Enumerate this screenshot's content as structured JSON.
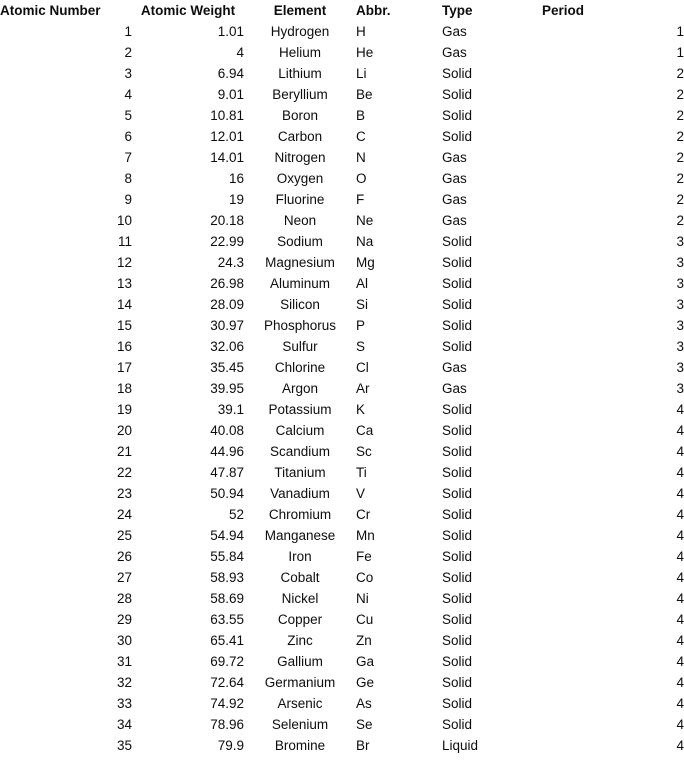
{
  "table": {
    "columns": [
      {
        "key": "atomic_number",
        "label": "Atomic Number",
        "align": "right"
      },
      {
        "key": "atomic_weight",
        "label": "Atomic Weight",
        "align": "right"
      },
      {
        "key": "element",
        "label": "Element",
        "align": "center"
      },
      {
        "key": "abbr",
        "label": "Abbr.",
        "align": "left"
      },
      {
        "key": "type",
        "label": "Type",
        "align": "left"
      },
      {
        "key": "period",
        "label": "Period",
        "align": "right"
      }
    ],
    "rows": [
      {
        "atomic_number": "1",
        "atomic_weight": "1.01",
        "element": "Hydrogen",
        "abbr": "H",
        "type": "Gas",
        "period": "1"
      },
      {
        "atomic_number": "2",
        "atomic_weight": "4",
        "element": "Helium",
        "abbr": "He",
        "type": "Gas",
        "period": "1"
      },
      {
        "atomic_number": "3",
        "atomic_weight": "6.94",
        "element": "Lithium",
        "abbr": "Li",
        "type": "Solid",
        "period": "2"
      },
      {
        "atomic_number": "4",
        "atomic_weight": "9.01",
        "element": "Beryllium",
        "abbr": "Be",
        "type": "Solid",
        "period": "2"
      },
      {
        "atomic_number": "5",
        "atomic_weight": "10.81",
        "element": "Boron",
        "abbr": "B",
        "type": "Solid",
        "period": "2"
      },
      {
        "atomic_number": "6",
        "atomic_weight": "12.01",
        "element": "Carbon",
        "abbr": "C",
        "type": "Solid",
        "period": "2"
      },
      {
        "atomic_number": "7",
        "atomic_weight": "14.01",
        "element": "Nitrogen",
        "abbr": "N",
        "type": "Gas",
        "period": "2"
      },
      {
        "atomic_number": "8",
        "atomic_weight": "16",
        "element": "Oxygen",
        "abbr": "O",
        "type": "Gas",
        "period": "2"
      },
      {
        "atomic_number": "9",
        "atomic_weight": "19",
        "element": "Fluorine",
        "abbr": "F",
        "type": "Gas",
        "period": "2"
      },
      {
        "atomic_number": "10",
        "atomic_weight": "20.18",
        "element": "Neon",
        "abbr": "Ne",
        "type": "Gas",
        "period": "2"
      },
      {
        "atomic_number": "11",
        "atomic_weight": "22.99",
        "element": "Sodium",
        "abbr": "Na",
        "type": "Solid",
        "period": "3"
      },
      {
        "atomic_number": "12",
        "atomic_weight": "24.3",
        "element": "Magnesium",
        "abbr": "Mg",
        "type": "Solid",
        "period": "3"
      },
      {
        "atomic_number": "13",
        "atomic_weight": "26.98",
        "element": "Aluminum",
        "abbr": "Al",
        "type": "Solid",
        "period": "3"
      },
      {
        "atomic_number": "14",
        "atomic_weight": "28.09",
        "element": "Silicon",
        "abbr": "Si",
        "type": "Solid",
        "period": "3"
      },
      {
        "atomic_number": "15",
        "atomic_weight": "30.97",
        "element": "Phosphorus",
        "abbr": "P",
        "type": "Solid",
        "period": "3"
      },
      {
        "atomic_number": "16",
        "atomic_weight": "32.06",
        "element": "Sulfur",
        "abbr": "S",
        "type": "Solid",
        "period": "3"
      },
      {
        "atomic_number": "17",
        "atomic_weight": "35.45",
        "element": "Chlorine",
        "abbr": "Cl",
        "type": "Gas",
        "period": "3"
      },
      {
        "atomic_number": "18",
        "atomic_weight": "39.95",
        "element": "Argon",
        "abbr": "Ar",
        "type": "Gas",
        "period": "3"
      },
      {
        "atomic_number": "19",
        "atomic_weight": "39.1",
        "element": "Potassium",
        "abbr": "K",
        "type": "Solid",
        "period": "4"
      },
      {
        "atomic_number": "20",
        "atomic_weight": "40.08",
        "element": "Calcium",
        "abbr": "Ca",
        "type": "Solid",
        "period": "4"
      },
      {
        "atomic_number": "21",
        "atomic_weight": "44.96",
        "element": "Scandium",
        "abbr": "Sc",
        "type": "Solid",
        "period": "4"
      },
      {
        "atomic_number": "22",
        "atomic_weight": "47.87",
        "element": "Titanium",
        "abbr": "Ti",
        "type": "Solid",
        "period": "4"
      },
      {
        "atomic_number": "23",
        "atomic_weight": "50.94",
        "element": "Vanadium",
        "abbr": "V",
        "type": "Solid",
        "period": "4"
      },
      {
        "atomic_number": "24",
        "atomic_weight": "52",
        "element": "Chromium",
        "abbr": "Cr",
        "type": "Solid",
        "period": "4"
      },
      {
        "atomic_number": "25",
        "atomic_weight": "54.94",
        "element": "Manganese",
        "abbr": "Mn",
        "type": "Solid",
        "period": "4"
      },
      {
        "atomic_number": "26",
        "atomic_weight": "55.84",
        "element": "Iron",
        "abbr": "Fe",
        "type": "Solid",
        "period": "4"
      },
      {
        "atomic_number": "27",
        "atomic_weight": "58.93",
        "element": "Cobalt",
        "abbr": "Co",
        "type": "Solid",
        "period": "4"
      },
      {
        "atomic_number": "28",
        "atomic_weight": "58.69",
        "element": "Nickel",
        "abbr": "Ni",
        "type": "Solid",
        "period": "4"
      },
      {
        "atomic_number": "29",
        "atomic_weight": "63.55",
        "element": "Copper",
        "abbr": "Cu",
        "type": "Solid",
        "period": "4"
      },
      {
        "atomic_number": "30",
        "atomic_weight": "65.41",
        "element": "Zinc",
        "abbr": "Zn",
        "type": "Solid",
        "period": "4"
      },
      {
        "atomic_number": "31",
        "atomic_weight": "69.72",
        "element": "Gallium",
        "abbr": "Ga",
        "type": "Solid",
        "period": "4"
      },
      {
        "atomic_number": "32",
        "atomic_weight": "72.64",
        "element": "Germanium",
        "abbr": "Ge",
        "type": "Solid",
        "period": "4"
      },
      {
        "atomic_number": "33",
        "atomic_weight": "74.92",
        "element": "Arsenic",
        "abbr": "As",
        "type": "Solid",
        "period": "4"
      },
      {
        "atomic_number": "34",
        "atomic_weight": "78.96",
        "element": "Selenium",
        "abbr": "Se",
        "type": "Solid",
        "period": "4"
      },
      {
        "atomic_number": "35",
        "atomic_weight": "79.9",
        "element": "Bromine",
        "abbr": "Br",
        "type": "Liquid",
        "period": "4"
      }
    ]
  },
  "colors": {
    "background": "#ffffff",
    "text": "#0d0d0d"
  }
}
